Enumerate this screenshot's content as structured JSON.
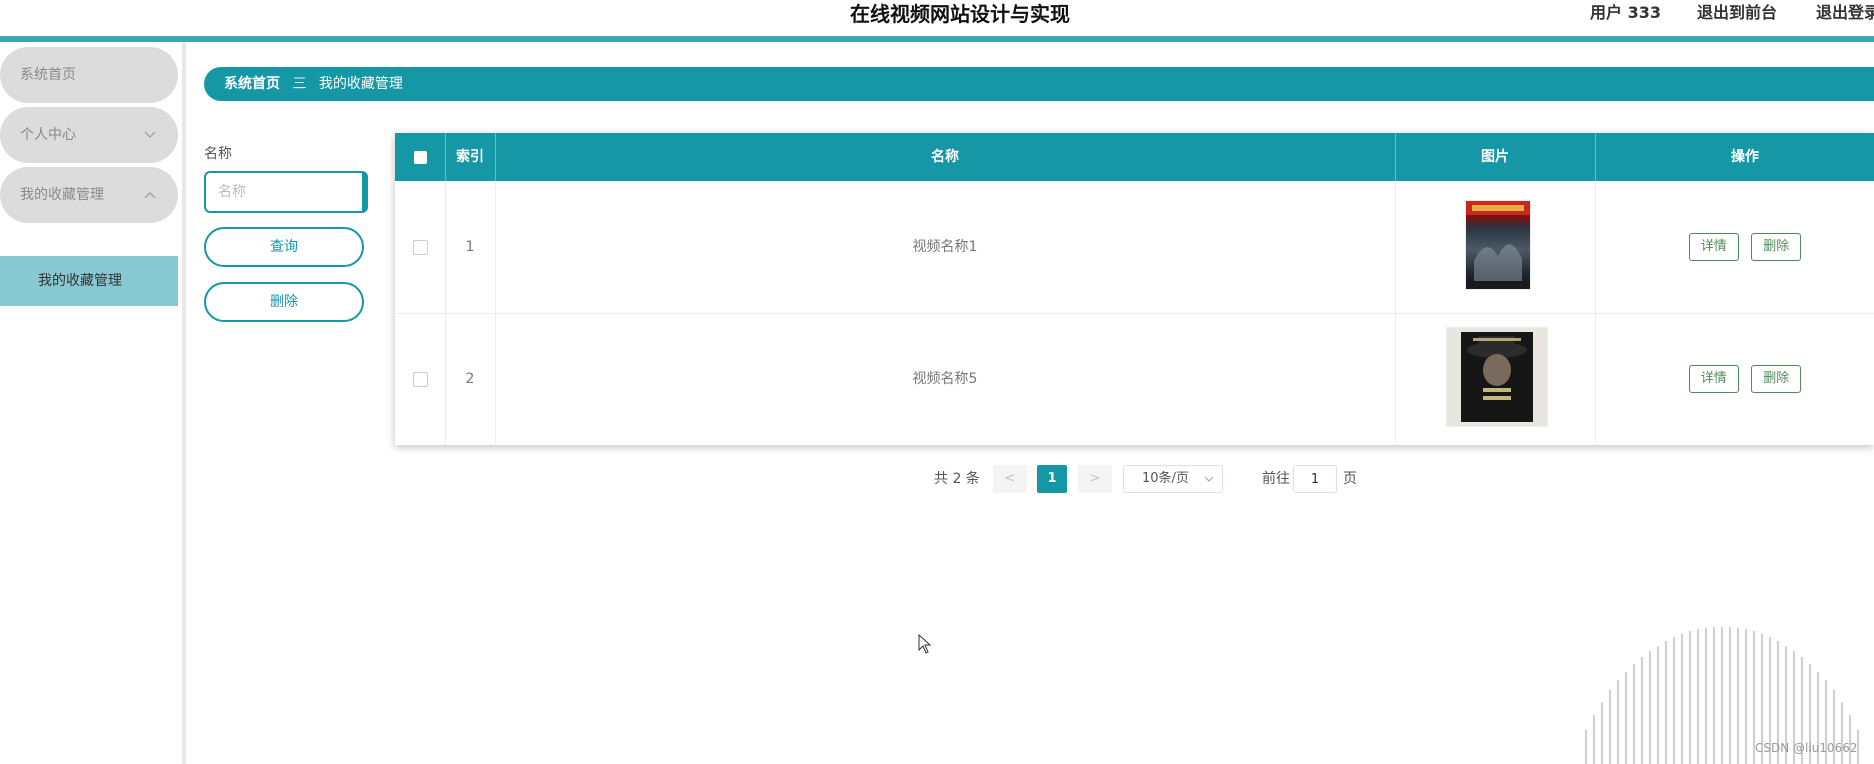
{
  "header": {
    "title": "在线视频网站设计与实现",
    "user": "用户 333",
    "exit_front": "退出到前台",
    "logout": "退出登录"
  },
  "sidebar": {
    "items": [
      {
        "label": "系统首页"
      },
      {
        "label": "个人中心"
      },
      {
        "label": "我的收藏管理"
      }
    ],
    "subitems": [
      {
        "label": "我的收藏管理"
      }
    ]
  },
  "breadcrumb": {
    "home": "系统首页",
    "separator": "三",
    "current": "我的收藏管理"
  },
  "search": {
    "label": "名称",
    "placeholder": "名称",
    "query_button": "查询",
    "delete_button": "删除"
  },
  "table": {
    "headers": {
      "index": "索引",
      "name": "名称",
      "image": "图片",
      "actions": "操作"
    },
    "rows": [
      {
        "index": "1",
        "name": "视频名称1",
        "detail": "详情",
        "delete": "删除"
      },
      {
        "index": "2",
        "name": "视频名称5",
        "detail": "详情",
        "delete": "删除"
      }
    ]
  },
  "pagination": {
    "total": "共 2 条",
    "prev": "<",
    "current": "1",
    "next": ">",
    "page_size": "10条/页",
    "goto_label": "前往",
    "goto_value": "1",
    "page_suffix": "页"
  },
  "watermark": "CSDN @liu10662",
  "colors": {
    "primary": "#1597a6",
    "header_border": "#3fa4ae",
    "menu_bg": "#dcdcdc",
    "submenu_bg": "#86c9d2"
  }
}
